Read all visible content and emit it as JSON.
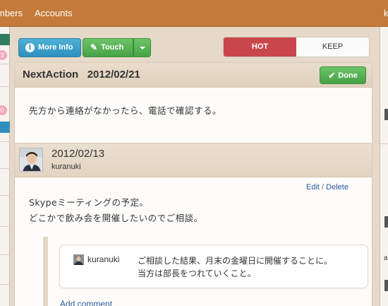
{
  "nav": {
    "members": "mbers",
    "accounts": "Accounts",
    "user": "k"
  },
  "left_panel": {
    "badges": [
      "3",
      "0"
    ]
  },
  "right_panel": {
    "letter": "a"
  },
  "toolbar": {
    "more_info_label": "More Info",
    "touch_label": "Touch",
    "hot_label": "HOT",
    "keep_label": "KEEP"
  },
  "next_action": {
    "title": "NextAction",
    "date": "2012/02/21",
    "done_label": "Done",
    "body": "先方から連絡がなかったら、電話で確認する。"
  },
  "comment": {
    "date": "2012/02/13",
    "user": "kuranuki",
    "edit_label": "Edit",
    "separator": "/",
    "delete_label": "Delete",
    "lines": [
      "Skypeミーティングの予定。",
      "どこかで飲み会を開催したいのでご相談。"
    ],
    "reply": {
      "user": "kuranuki",
      "lines": [
        "ご相談した結果、月末の金曜日に開催することに。",
        "当方は部長をつれていくこと。"
      ]
    },
    "add_comment_label": "Add comment"
  },
  "colors": {
    "nav_bg": "#c37a3a",
    "info_button": "#2e8fbd",
    "success_button": "#48a246",
    "hot_active": "#c9464a",
    "link": "#2a5a98"
  }
}
